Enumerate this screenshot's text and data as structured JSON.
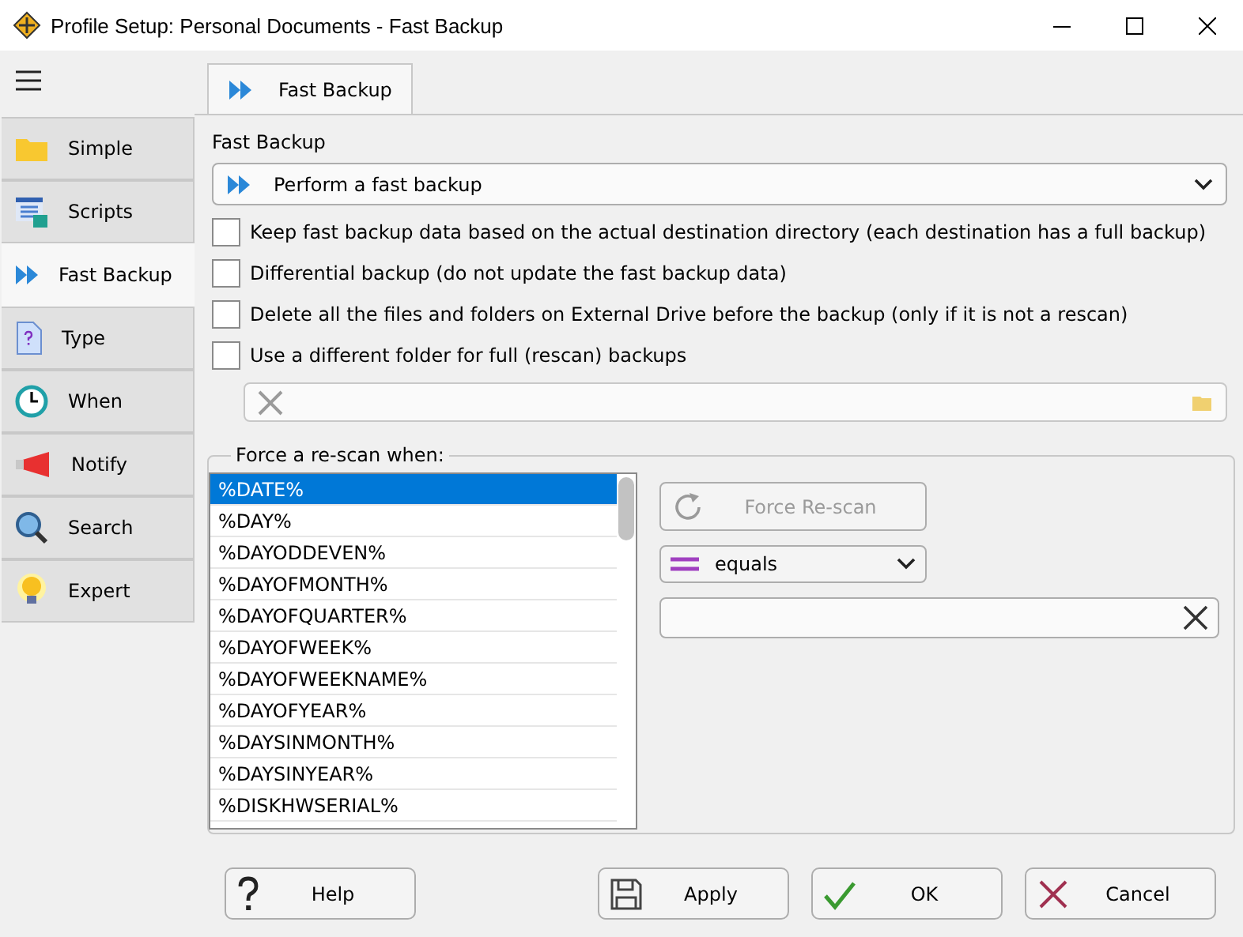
{
  "window": {
    "title": "Profile Setup: Personal Documents - Fast Backup"
  },
  "sidebar": {
    "items": [
      {
        "label": "Simple",
        "selected": false
      },
      {
        "label": "Scripts",
        "selected": false
      },
      {
        "label": "Fast Backup",
        "selected": true
      },
      {
        "label": "Type",
        "selected": false
      },
      {
        "label": "When",
        "selected": false
      },
      {
        "label": "Notify",
        "selected": false
      },
      {
        "label": "Search",
        "selected": false
      },
      {
        "label": "Expert",
        "selected": false
      }
    ]
  },
  "tabs": [
    {
      "label": "Fast Backup",
      "selected": true
    }
  ],
  "fast_backup": {
    "label": "Fast Backup",
    "mode": "Perform a fast backup"
  },
  "options": [
    {
      "label": "Keep fast backup data based on the actual destination directory (each destination has a full backup)",
      "checked": false
    },
    {
      "label": "Differential backup (do not update the fast backup data)",
      "checked": false
    },
    {
      "label": "Delete all the files and folders on External Drive before the backup (only if it is not a rescan)",
      "checked": false
    },
    {
      "label": "Use a different folder for full (rescan) backups",
      "checked": false
    }
  ],
  "rescan": {
    "legend": "Force a re-scan when:",
    "items": [
      {
        "label": "%DATE%",
        "selected": true
      },
      {
        "label": "%DAY%",
        "selected": false
      },
      {
        "label": "%DAYODDEVEN%",
        "selected": false
      },
      {
        "label": "%DAYOFMONTH%",
        "selected": false
      },
      {
        "label": "%DAYOFQUARTER%",
        "selected": false
      },
      {
        "label": "%DAYOFWEEK%",
        "selected": false
      },
      {
        "label": "%DAYOFWEEKNAME%",
        "selected": false
      },
      {
        "label": "%DAYOFYEAR%",
        "selected": false
      },
      {
        "label": "%DAYSINMONTH%",
        "selected": false
      },
      {
        "label": "%DAYSINYEAR%",
        "selected": false
      },
      {
        "label": "%DISKHWSERIAL%",
        "selected": false
      }
    ],
    "button": {
      "label": "Force Re-scan",
      "disabled": true
    },
    "operator": "equals"
  },
  "buttons": [
    "Help",
    "Apply",
    "OK",
    "Cancel"
  ]
}
